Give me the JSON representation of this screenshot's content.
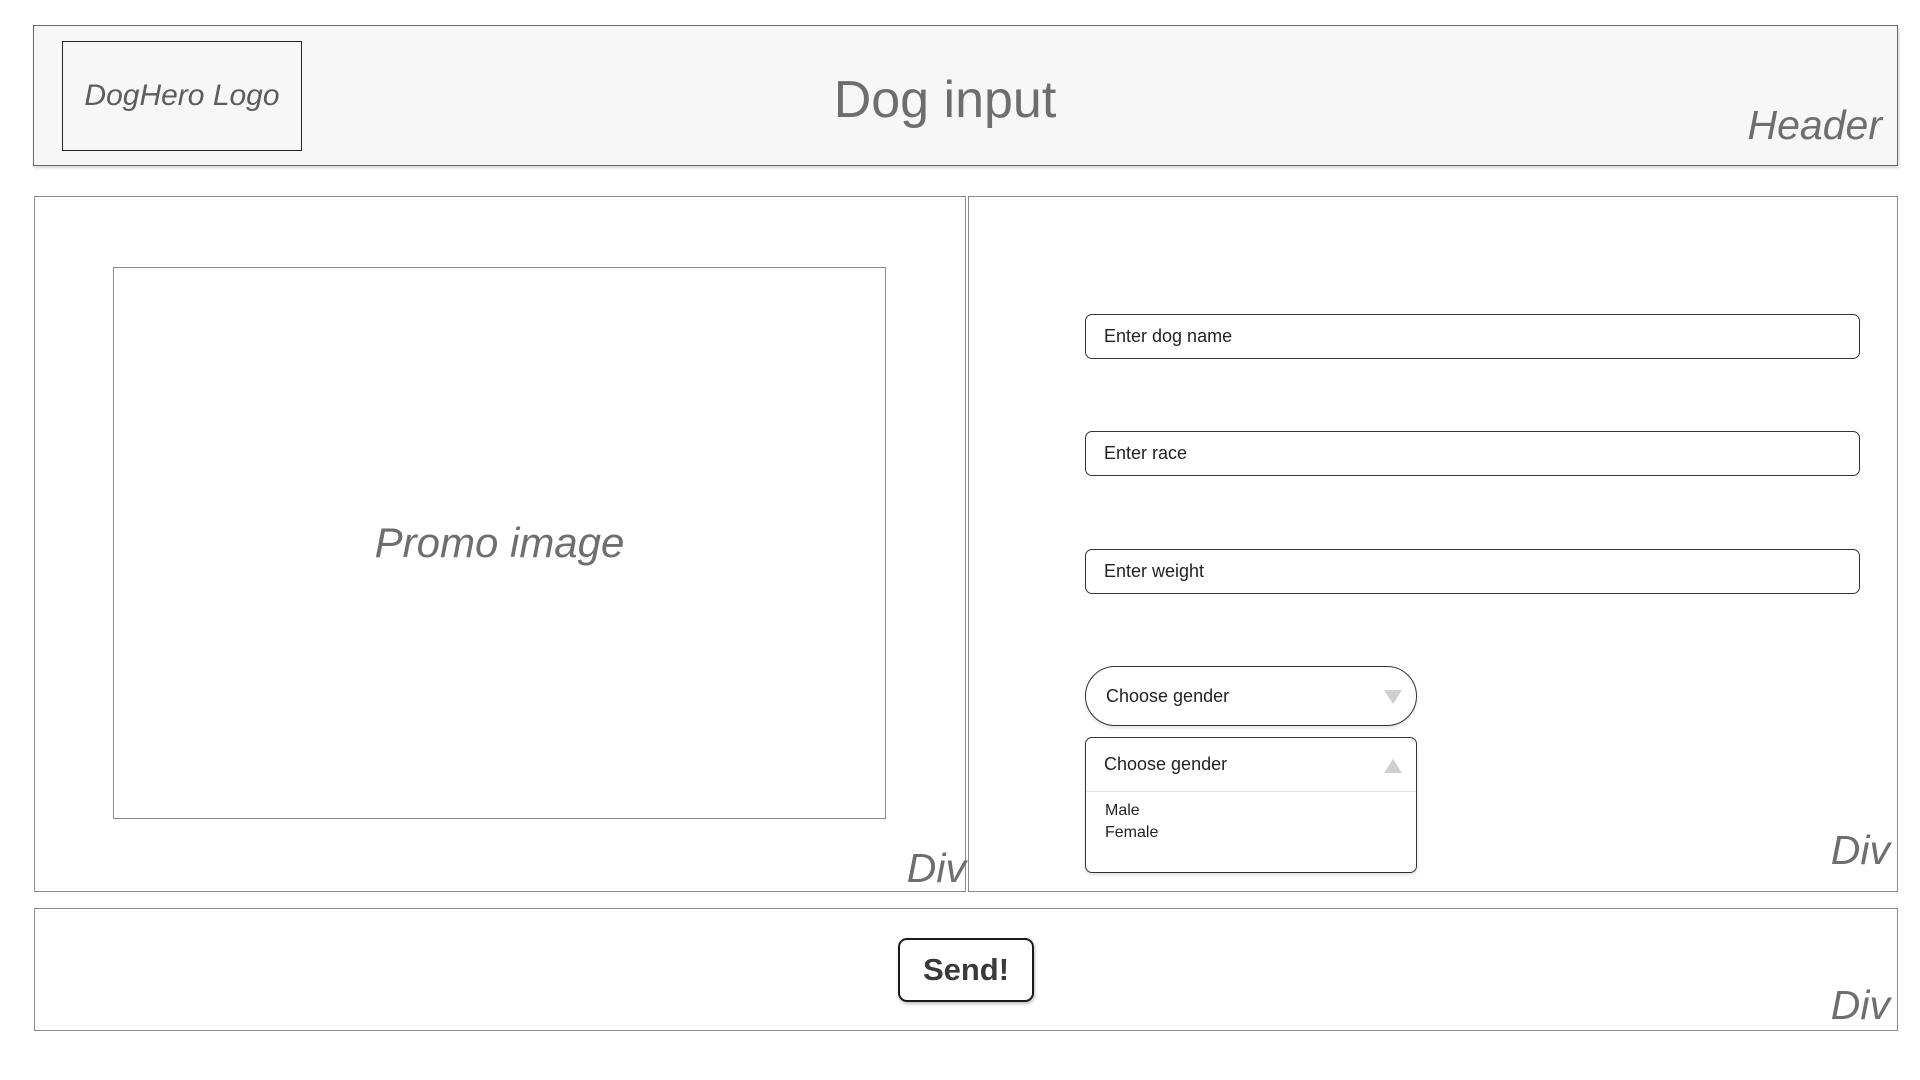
{
  "header": {
    "logo_text": "DogHero Logo",
    "title": "Dog input",
    "region_label": "Header"
  },
  "left_panel": {
    "promo_text": "Promo image",
    "region_label": "Div"
  },
  "form": {
    "dog_name_placeholder": "Enter dog name",
    "race_placeholder": "Enter race",
    "weight_placeholder": "Enter weight",
    "gender_select": {
      "selected": "Choose gender",
      "arrow_icon": "triangle-down-icon"
    },
    "gender_dropdown": {
      "header": "Choose gender",
      "arrow_icon": "triangle-up-icon",
      "options": [
        "Male",
        "Female"
      ]
    },
    "region_label": "Div"
  },
  "footer": {
    "send_label": "Send!",
    "region_label": "Div"
  }
}
